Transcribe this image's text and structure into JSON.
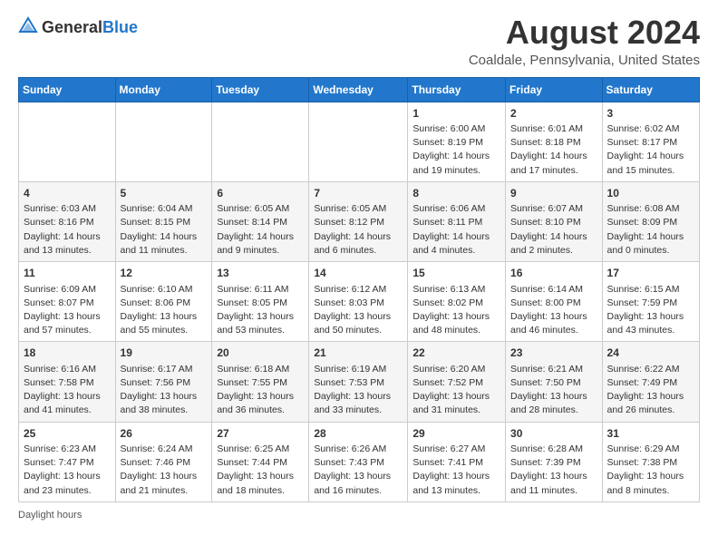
{
  "header": {
    "logo_general": "General",
    "logo_blue": "Blue",
    "title": "August 2024",
    "subtitle": "Coaldale, Pennsylvania, United States"
  },
  "days_of_week": [
    "Sunday",
    "Monday",
    "Tuesday",
    "Wednesday",
    "Thursday",
    "Friday",
    "Saturday"
  ],
  "weeks": [
    [
      {
        "day": "",
        "data": ""
      },
      {
        "day": "",
        "data": ""
      },
      {
        "day": "",
        "data": ""
      },
      {
        "day": "",
        "data": ""
      },
      {
        "day": "1",
        "data": "Sunrise: 6:00 AM\nSunset: 8:19 PM\nDaylight: 14 hours and 19 minutes."
      },
      {
        "day": "2",
        "data": "Sunrise: 6:01 AM\nSunset: 8:18 PM\nDaylight: 14 hours and 17 minutes."
      },
      {
        "day": "3",
        "data": "Sunrise: 6:02 AM\nSunset: 8:17 PM\nDaylight: 14 hours and 15 minutes."
      }
    ],
    [
      {
        "day": "4",
        "data": "Sunrise: 6:03 AM\nSunset: 8:16 PM\nDaylight: 14 hours and 13 minutes."
      },
      {
        "day": "5",
        "data": "Sunrise: 6:04 AM\nSunset: 8:15 PM\nDaylight: 14 hours and 11 minutes."
      },
      {
        "day": "6",
        "data": "Sunrise: 6:05 AM\nSunset: 8:14 PM\nDaylight: 14 hours and 9 minutes."
      },
      {
        "day": "7",
        "data": "Sunrise: 6:05 AM\nSunset: 8:12 PM\nDaylight: 14 hours and 6 minutes."
      },
      {
        "day": "8",
        "data": "Sunrise: 6:06 AM\nSunset: 8:11 PM\nDaylight: 14 hours and 4 minutes."
      },
      {
        "day": "9",
        "data": "Sunrise: 6:07 AM\nSunset: 8:10 PM\nDaylight: 14 hours and 2 minutes."
      },
      {
        "day": "10",
        "data": "Sunrise: 6:08 AM\nSunset: 8:09 PM\nDaylight: 14 hours and 0 minutes."
      }
    ],
    [
      {
        "day": "11",
        "data": "Sunrise: 6:09 AM\nSunset: 8:07 PM\nDaylight: 13 hours and 57 minutes."
      },
      {
        "day": "12",
        "data": "Sunrise: 6:10 AM\nSunset: 8:06 PM\nDaylight: 13 hours and 55 minutes."
      },
      {
        "day": "13",
        "data": "Sunrise: 6:11 AM\nSunset: 8:05 PM\nDaylight: 13 hours and 53 minutes."
      },
      {
        "day": "14",
        "data": "Sunrise: 6:12 AM\nSunset: 8:03 PM\nDaylight: 13 hours and 50 minutes."
      },
      {
        "day": "15",
        "data": "Sunrise: 6:13 AM\nSunset: 8:02 PM\nDaylight: 13 hours and 48 minutes."
      },
      {
        "day": "16",
        "data": "Sunrise: 6:14 AM\nSunset: 8:00 PM\nDaylight: 13 hours and 46 minutes."
      },
      {
        "day": "17",
        "data": "Sunrise: 6:15 AM\nSunset: 7:59 PM\nDaylight: 13 hours and 43 minutes."
      }
    ],
    [
      {
        "day": "18",
        "data": "Sunrise: 6:16 AM\nSunset: 7:58 PM\nDaylight: 13 hours and 41 minutes."
      },
      {
        "day": "19",
        "data": "Sunrise: 6:17 AM\nSunset: 7:56 PM\nDaylight: 13 hours and 38 minutes."
      },
      {
        "day": "20",
        "data": "Sunrise: 6:18 AM\nSunset: 7:55 PM\nDaylight: 13 hours and 36 minutes."
      },
      {
        "day": "21",
        "data": "Sunrise: 6:19 AM\nSunset: 7:53 PM\nDaylight: 13 hours and 33 minutes."
      },
      {
        "day": "22",
        "data": "Sunrise: 6:20 AM\nSunset: 7:52 PM\nDaylight: 13 hours and 31 minutes."
      },
      {
        "day": "23",
        "data": "Sunrise: 6:21 AM\nSunset: 7:50 PM\nDaylight: 13 hours and 28 minutes."
      },
      {
        "day": "24",
        "data": "Sunrise: 6:22 AM\nSunset: 7:49 PM\nDaylight: 13 hours and 26 minutes."
      }
    ],
    [
      {
        "day": "25",
        "data": "Sunrise: 6:23 AM\nSunset: 7:47 PM\nDaylight: 13 hours and 23 minutes."
      },
      {
        "day": "26",
        "data": "Sunrise: 6:24 AM\nSunset: 7:46 PM\nDaylight: 13 hours and 21 minutes."
      },
      {
        "day": "27",
        "data": "Sunrise: 6:25 AM\nSunset: 7:44 PM\nDaylight: 13 hours and 18 minutes."
      },
      {
        "day": "28",
        "data": "Sunrise: 6:26 AM\nSunset: 7:43 PM\nDaylight: 13 hours and 16 minutes."
      },
      {
        "day": "29",
        "data": "Sunrise: 6:27 AM\nSunset: 7:41 PM\nDaylight: 13 hours and 13 minutes."
      },
      {
        "day": "30",
        "data": "Sunrise: 6:28 AM\nSunset: 7:39 PM\nDaylight: 13 hours and 11 minutes."
      },
      {
        "day": "31",
        "data": "Sunrise: 6:29 AM\nSunset: 7:38 PM\nDaylight: 13 hours and 8 minutes."
      }
    ]
  ],
  "footer": {
    "note_label": "Daylight hours"
  }
}
